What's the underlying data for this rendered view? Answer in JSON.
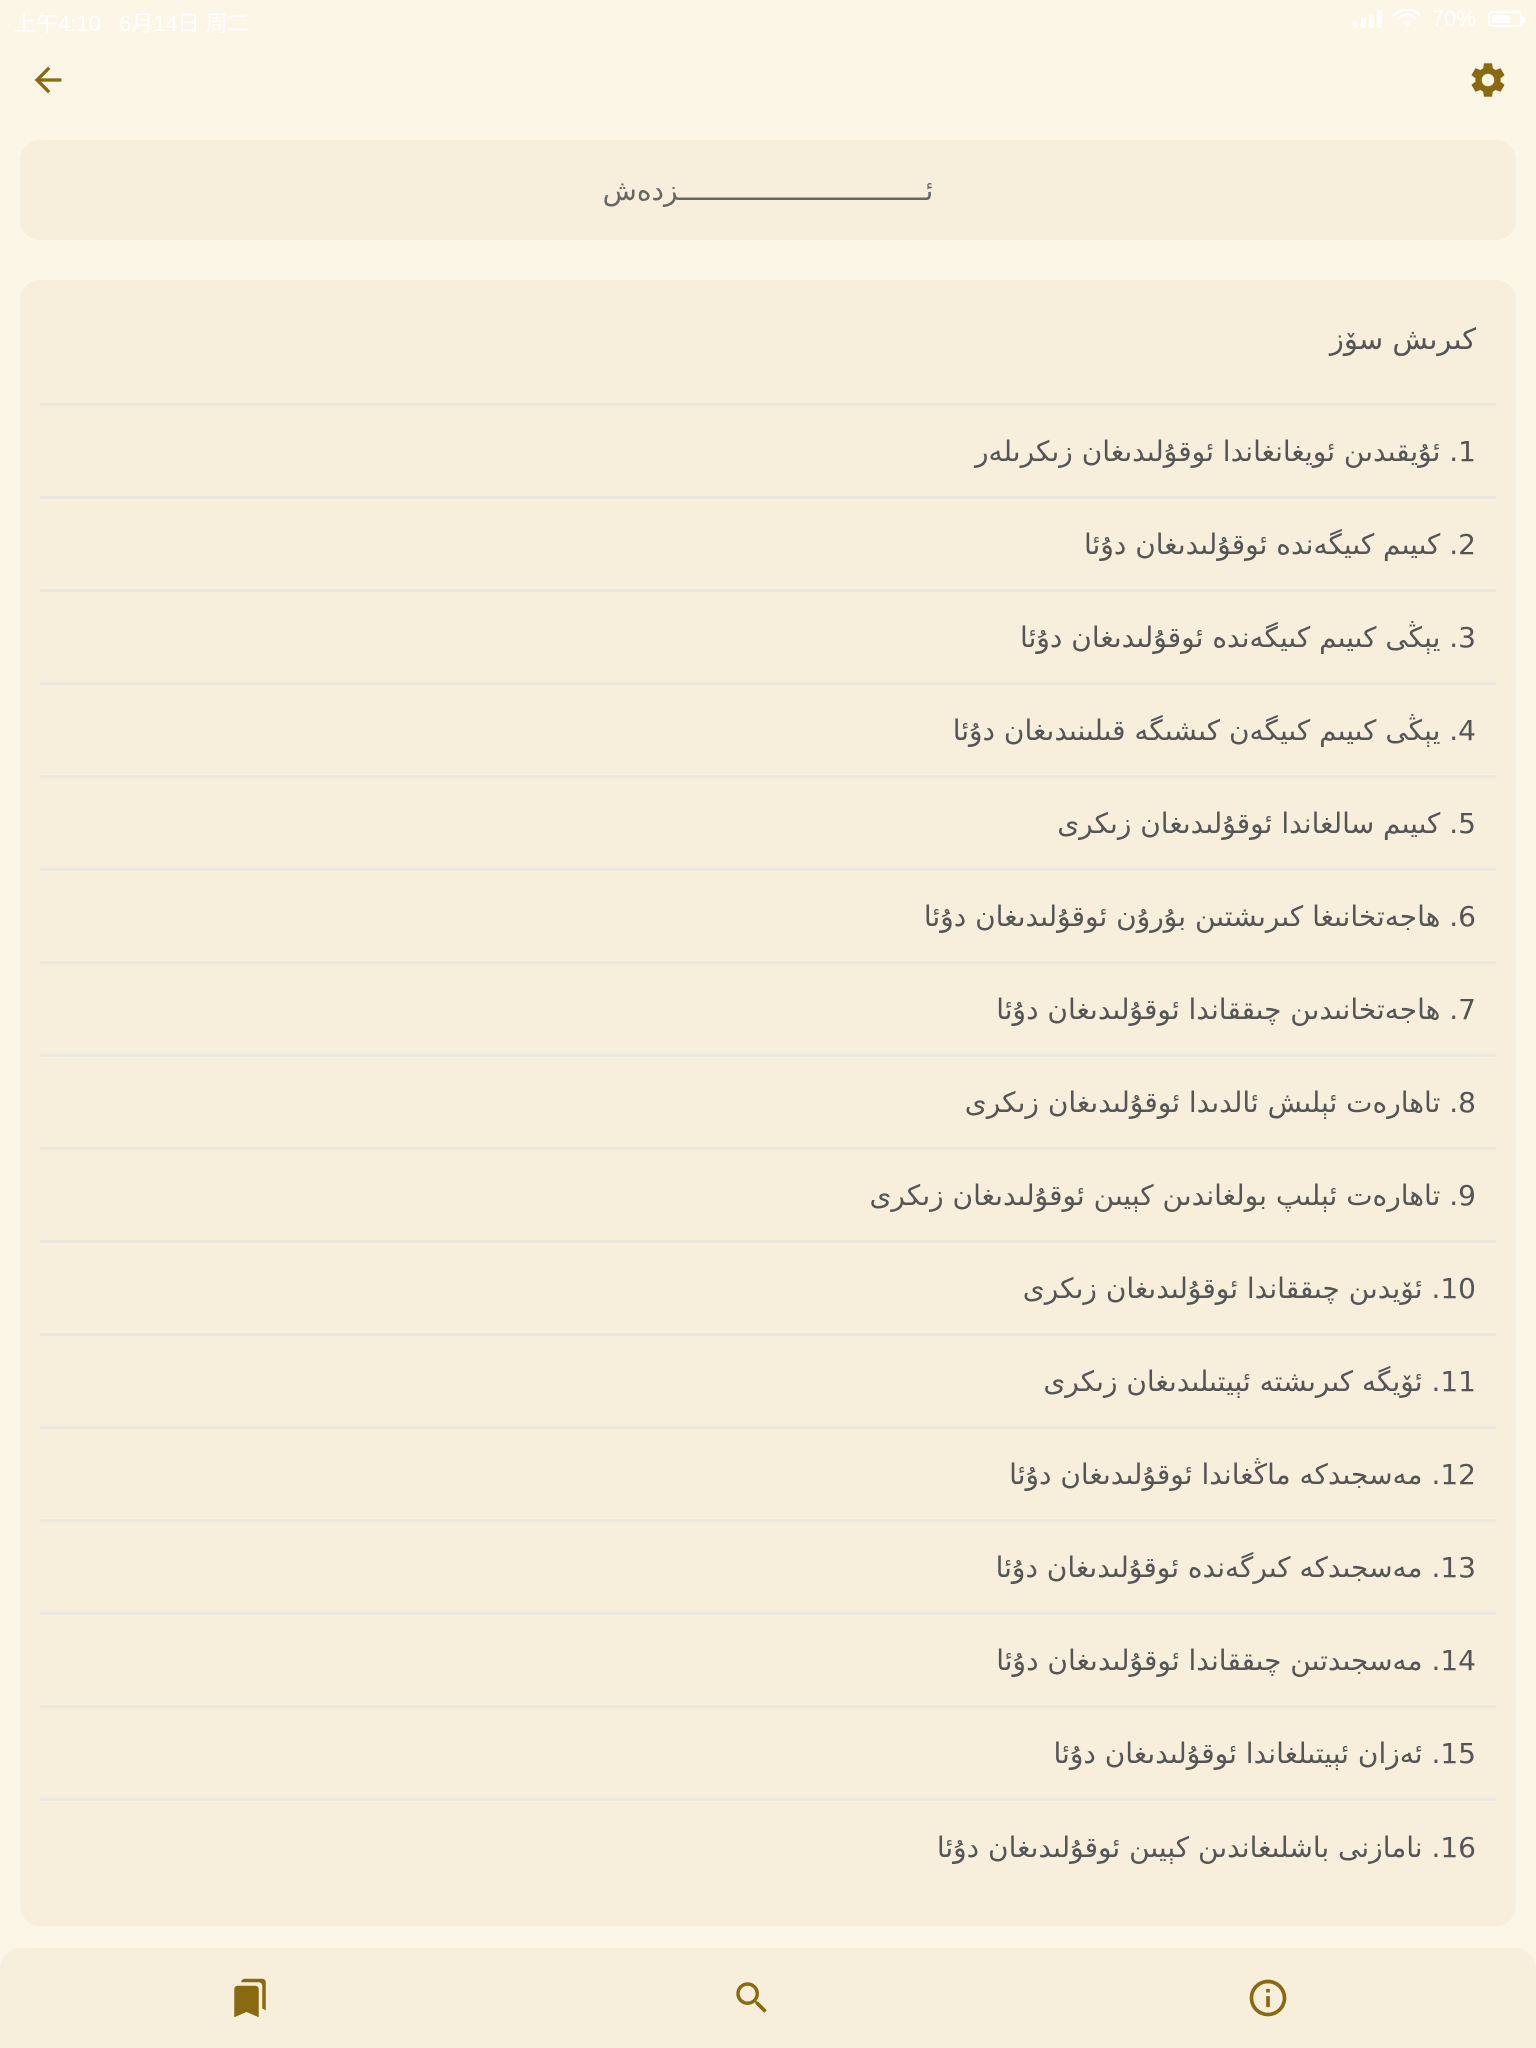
{
  "status_bar": {
    "time": "上午4:10",
    "date": "6月14日 周二",
    "battery": "70%",
    "battery_level": 0.7
  },
  "header": {
    "back_icon": "arrow-left-icon",
    "settings_icon": "gear-icon",
    "title": "ئــــــــــــــــــــــــــــــزدەش"
  },
  "accent_color": "#8a6a10",
  "list": {
    "section_header": "كىرىش سۆز",
    "items": [
      "1. ئۇيقىدىن ئويغانغاندا ئوقۇلىدىغان زىكرىلەر",
      "2. كىيىم كىيگەندە ئوقۇلىدىغان دۇئا",
      "3. يېڭى كىيىم كىيگەندە ئوقۇلىدىغان دۇئا",
      "4. يېڭى كىيىم كىيگەن كىشىگە قىلىنىدىغان دۇئا",
      "5. كىيىم سالغاندا ئوقۇلىدىغان زىكرى",
      "6. ھاجەتخانىغا كىرىشتىن بۇرۇن ئوقۇلىدىغان دۇئا",
      "7. ھاجەتخانىدىن چىققاندا ئوقۇلىدىغان دۇئا",
      "8. تاھارەت ئېلىش ئالدىدا ئوقۇلىدىغان زىكرى",
      "9. تاھارەت ئېلىپ بولغاندىن كېيىن ئوقۇلىدىغان زىكرى",
      "10. ئۆيدىن چىققاندا ئوقۇلىدىغان زىكرى",
      "11. ئۆيگە كىرىشتە ئېيتىلىدىغان زىكرى",
      "12. مەسجىدكە ماڭغاندا ئوقۇلىدىغان دۇئا",
      "13. مەسجىدكە كىرگەندە ئوقۇلىدىغان دۇئا",
      "14. مەسجىدتىن چىققاندا ئوقۇلىدىغان دۇئا",
      "15. ئەزان ئېيتىلغاندا ئوقۇلىدىغان دۇئا",
      "16. نامازنى باشلىغاندىن كېيىن ئوقۇلىدىغان دۇئا"
    ]
  },
  "bottom_nav": {
    "bookmarks_icon": "bookmarks-icon",
    "search_icon": "search-icon",
    "info_icon": "info-icon"
  }
}
